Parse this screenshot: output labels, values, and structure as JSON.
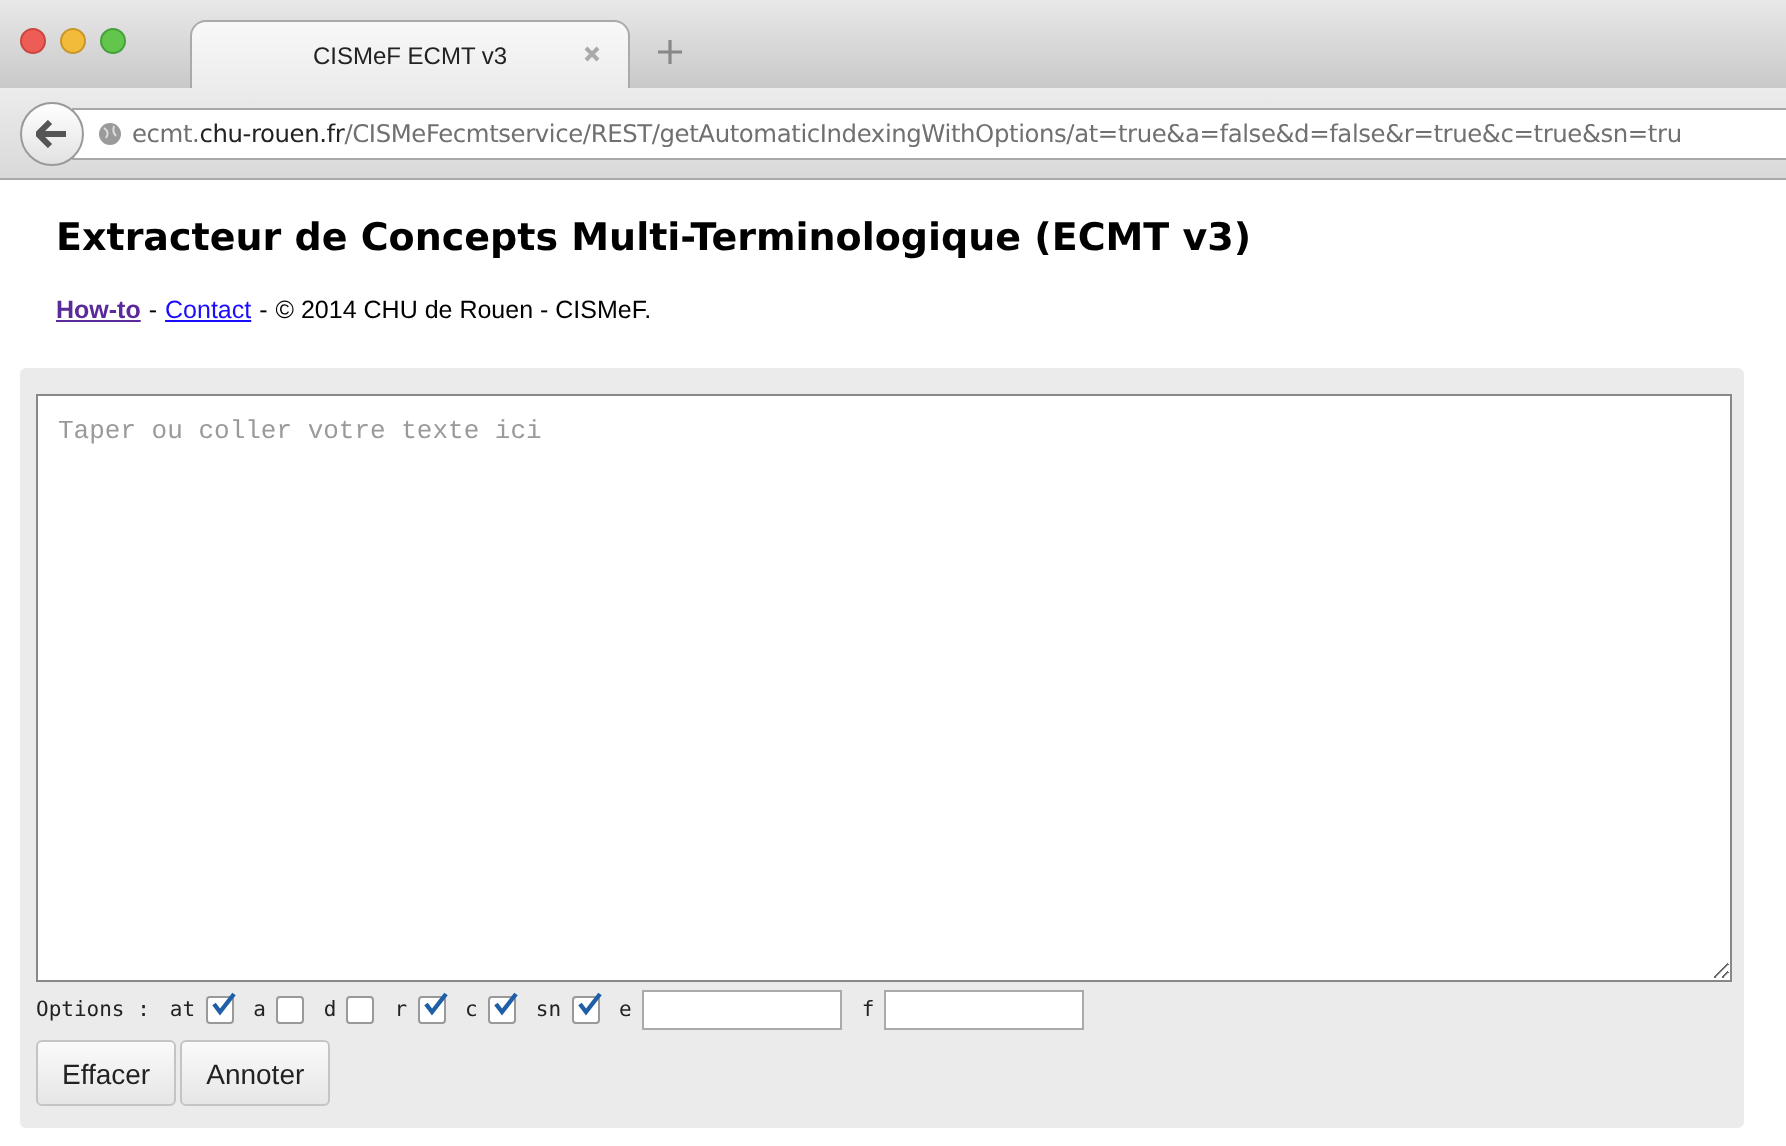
{
  "browser": {
    "tabs": [
      {
        "label": "CISMeF ECMT v3",
        "selected": true
      }
    ],
    "address": {
      "subdomain": "ecmt.",
      "domain": "chu-rouen.fr",
      "path": "/CISMeFecmtservice/REST/getAutomaticIndexingWithOptions/at=true&a=false&d=false&r=true&c=true&sn=tru"
    }
  },
  "page": {
    "title": "Extracteur de Concepts Multi-Terminologique (ECMT v3)",
    "links": [
      {
        "label": "How-to",
        "visited": true,
        "separator": "-"
      },
      {
        "label": "Contact",
        "visited": false,
        "separator": "-"
      }
    ],
    "credit": "© 2014 CHU de Rouen - CISMeF.",
    "editor": {
      "placeholder": "Taper ou coller votre texte ici"
    },
    "options_label": "Options :",
    "options": [
      {
        "kind": "checkbox",
        "label": "at",
        "checked": true
      },
      {
        "kind": "checkbox",
        "label": "a",
        "checked": false
      },
      {
        "kind": "checkbox",
        "label": "d",
        "checked": false
      },
      {
        "kind": "checkbox",
        "label": "r",
        "checked": true
      },
      {
        "kind": "checkbox",
        "label": "c",
        "checked": true
      },
      {
        "kind": "checkbox",
        "label": "sn",
        "checked": true
      },
      {
        "kind": "text",
        "label": "e"
      },
      {
        "kind": "text",
        "label": "f"
      }
    ],
    "buttons": [
      "Effacer",
      "Annoter"
    ]
  }
}
